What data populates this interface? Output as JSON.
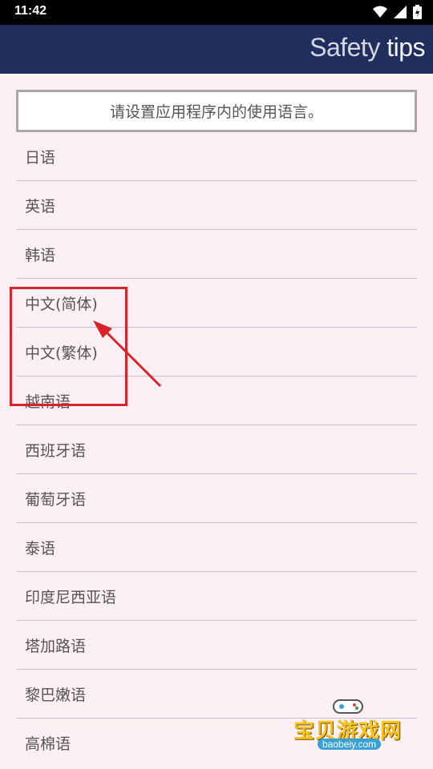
{
  "status_bar": {
    "time": "11:42"
  },
  "app_bar": {
    "title_part1": "Safety",
    "title_part2": "tips"
  },
  "prompt": {
    "text": "请设置应用程序内的使用语言。"
  },
  "languages": [
    "日语",
    "英语",
    "韩语",
    "中文(简体)",
    "中文(繁体)",
    "越南语",
    "西班牙语",
    "葡萄牙语",
    "泰语",
    "印度尼西亚语",
    "塔加路语",
    "黎巴嫩语",
    "高棉语"
  ],
  "watermark": {
    "brand": "宝贝游戏网",
    "url": "baobeiy.com"
  },
  "colors": {
    "app_bar": "#1f2e5c",
    "background": "#fdf0f4",
    "annotation": "#d8232a"
  },
  "icons": [
    "wifi-icon",
    "signal-icon",
    "battery-icon",
    "red-arrow-annotation"
  ]
}
